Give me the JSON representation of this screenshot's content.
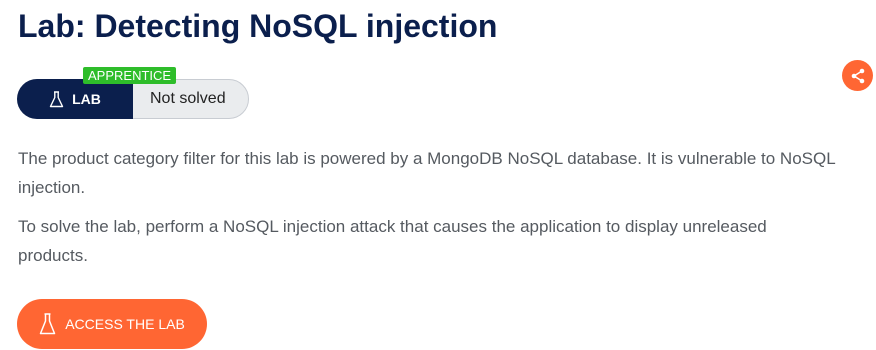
{
  "header": {
    "title": "Lab: Detecting NoSQL injection"
  },
  "lab_status": {
    "level_badge": "APPRENTICE",
    "type_label": "LAB",
    "type_icon": "flask-icon",
    "status": "Not solved"
  },
  "share": {
    "icon": "share-icon"
  },
  "description": {
    "paragraph_1": "The product category filter for this lab is powered by a MongoDB NoSQL database. It is vulnerable to NoSQL injection.",
    "paragraph_2": "To solve the lab, perform a NoSQL injection attack that causes the application to display unreleased products."
  },
  "actions": {
    "access_label": "ACCESS THE LAB",
    "access_icon": "flask-icon"
  },
  "colors": {
    "navy": "#0b1f4d",
    "accent_orange": "#ff6633",
    "badge_green": "#2ebd2a",
    "pill_grey": "#eaecee",
    "text_grey": "#555a60"
  }
}
